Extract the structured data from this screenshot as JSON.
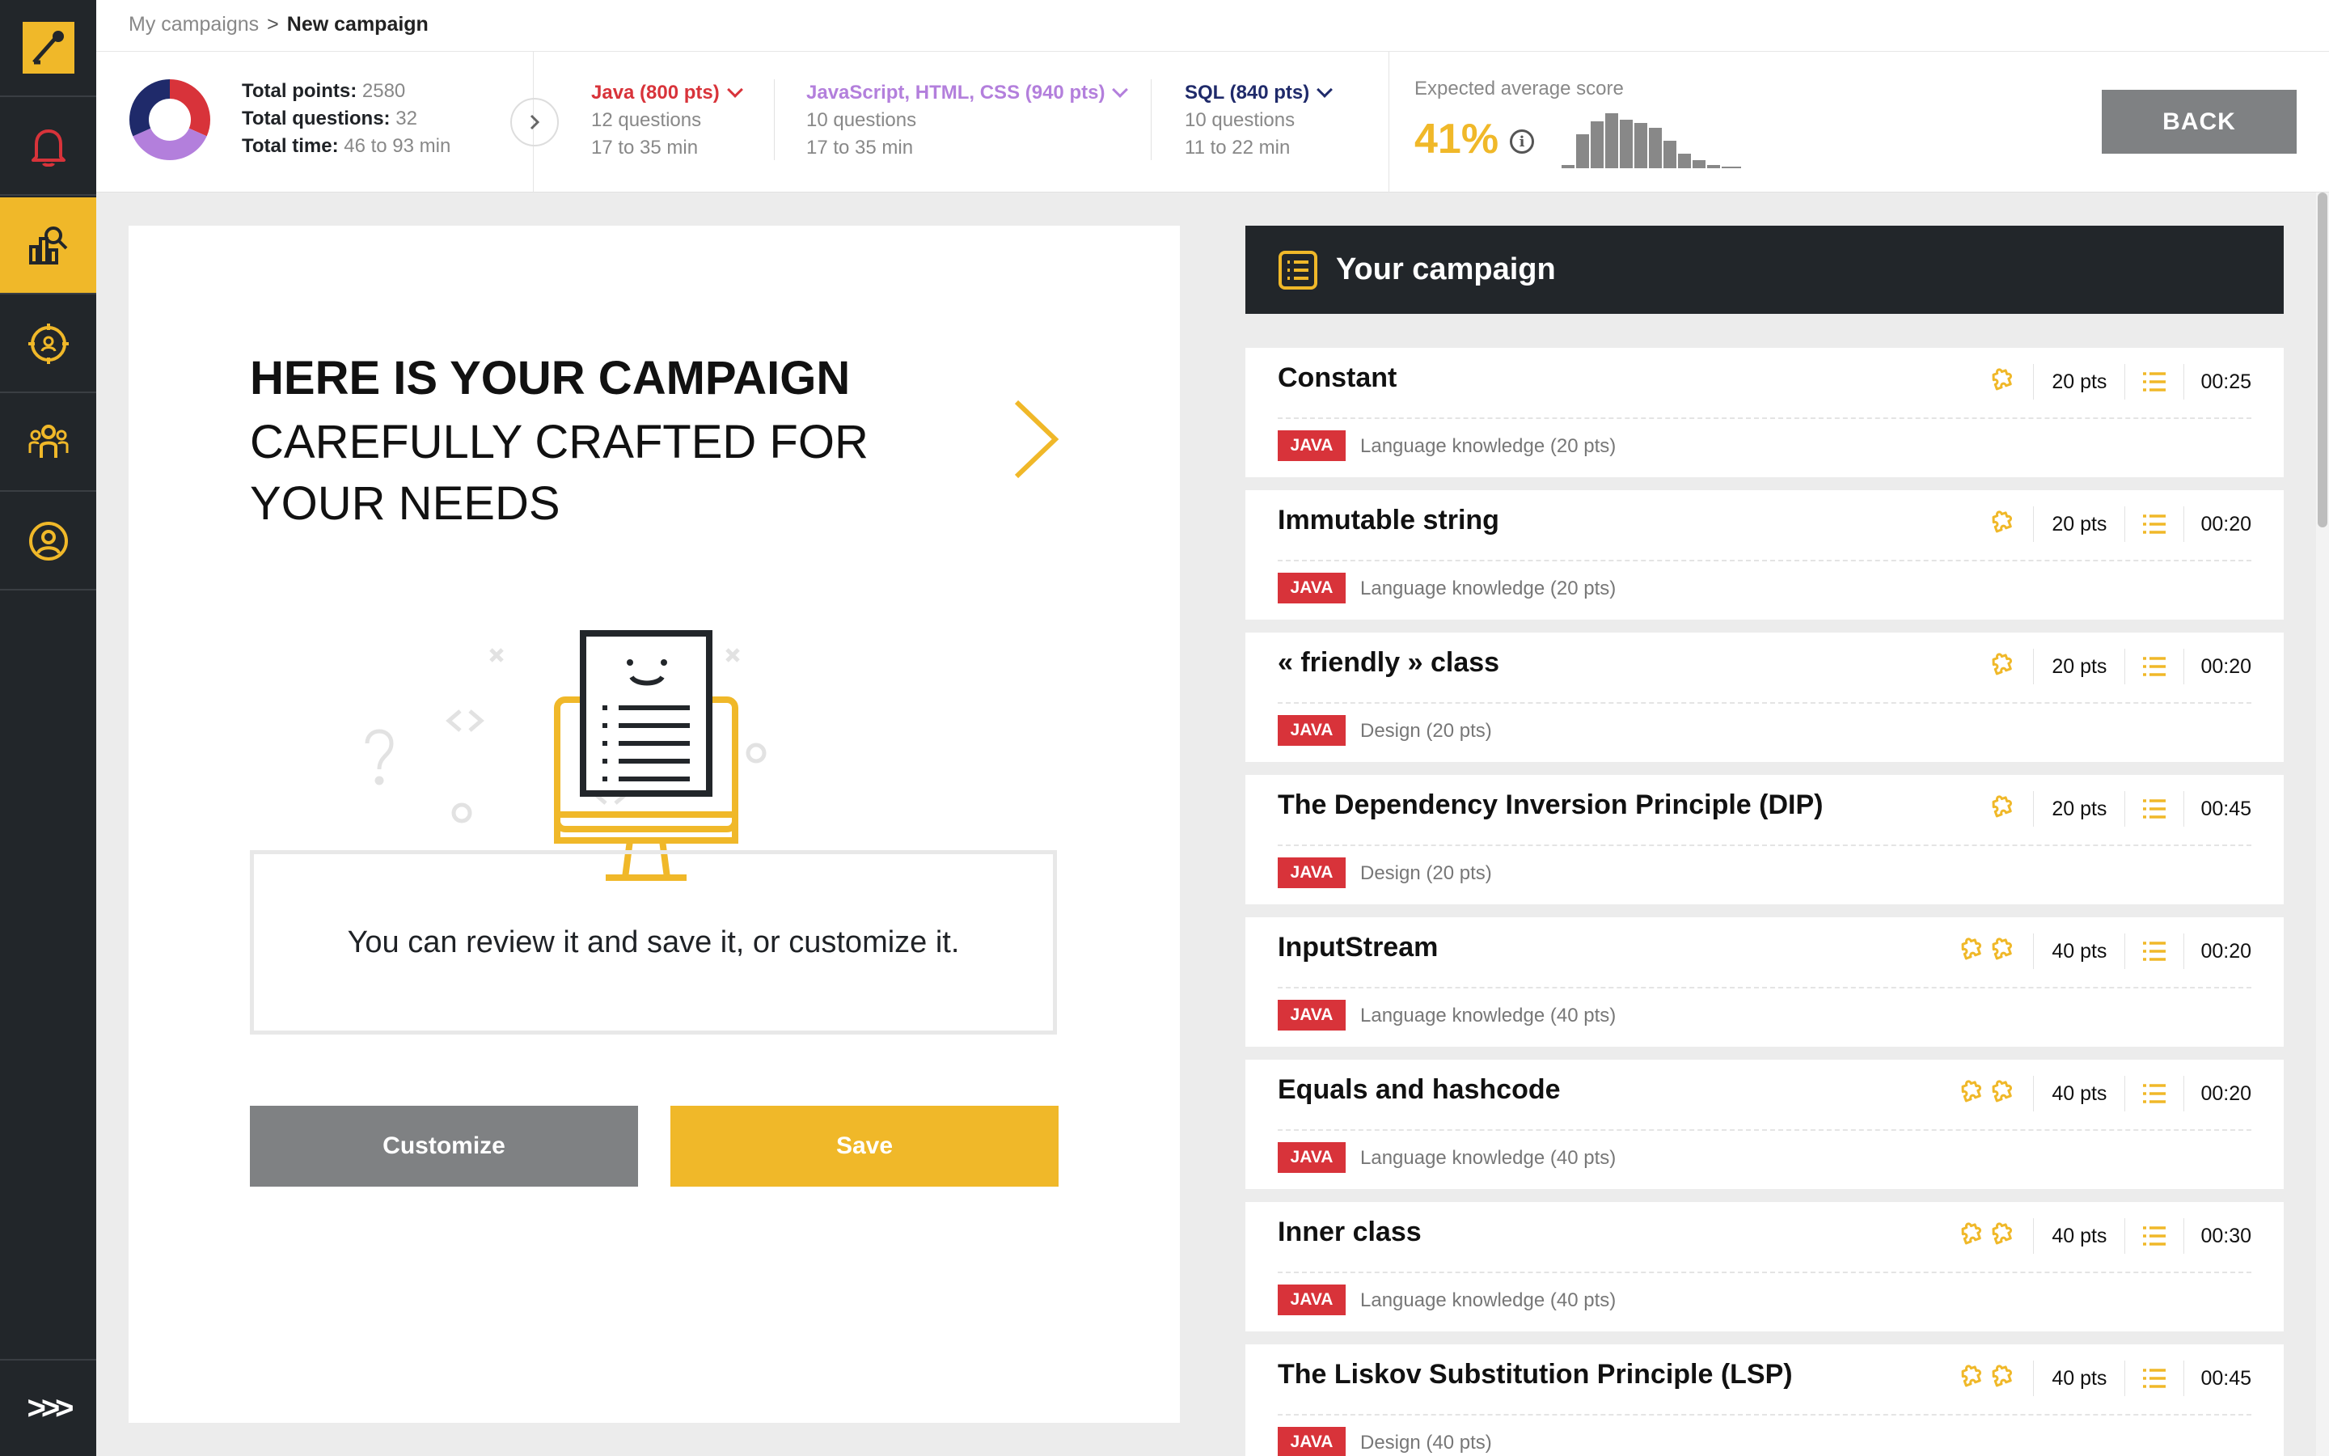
{
  "breadcrumb": {
    "parent": "My campaigns",
    "separator": ">",
    "current": "New campaign"
  },
  "totals": {
    "points_label": "Total points:",
    "points": "2580",
    "questions_label": "Total questions:",
    "questions": "32",
    "time_label": "Total time:",
    "time": "46 to 93 min"
  },
  "skills": [
    {
      "name": "Java (800 pts)",
      "questions": "12 questions",
      "time": "17 to 35 min",
      "color": "#d8333a"
    },
    {
      "name": "JavaScript, HTML, CSS (940 pts)",
      "questions": "10 questions",
      "time": "17 to 35 min",
      "color": "#b37fdc"
    },
    {
      "name": "SQL (840 pts)",
      "questions": "10 questions",
      "time": "11 to 22 min",
      "color": "#1f2a6a"
    }
  ],
  "score": {
    "label": "Expected average score",
    "value": "41%",
    "info_icon": "info-icon"
  },
  "back_label": "BACK",
  "hero": {
    "title": "HERE IS YOUR CAMPAIGN",
    "subtitle": "CAREFULLY CRAFTED FOR YOUR NEEDS",
    "review_text": "You can review it and save it, or customize it."
  },
  "buttons": {
    "customize": "Customize",
    "save": "Save"
  },
  "campaign": {
    "title": "Your campaign",
    "questions": [
      {
        "title": "Constant",
        "pts": "20 pts",
        "time": "00:25",
        "tag": "JAVA",
        "category": "Language knowledge (20 pts)",
        "difficulty": 1
      },
      {
        "title": "Immutable string",
        "pts": "20 pts",
        "time": "00:20",
        "tag": "JAVA",
        "category": "Language knowledge (20 pts)",
        "difficulty": 1
      },
      {
        "title": "« friendly » class",
        "pts": "20 pts",
        "time": "00:20",
        "tag": "JAVA",
        "category": "Design (20 pts)",
        "difficulty": 1
      },
      {
        "title": "The Dependency Inversion Principle (DIP)",
        "pts": "20 pts",
        "time": "00:45",
        "tag": "JAVA",
        "category": "Design (20 pts)",
        "difficulty": 1
      },
      {
        "title": "InputStream",
        "pts": "40 pts",
        "time": "00:20",
        "tag": "JAVA",
        "category": "Language knowledge (40 pts)",
        "difficulty": 2
      },
      {
        "title": "Equals and hashcode",
        "pts": "40 pts",
        "time": "00:20",
        "tag": "JAVA",
        "category": "Language knowledge (40 pts)",
        "difficulty": 2
      },
      {
        "title": "Inner class",
        "pts": "40 pts",
        "time": "00:30",
        "tag": "JAVA",
        "category": "Language knowledge (40 pts)",
        "difficulty": 2
      },
      {
        "title": "The Liskov Substitution Principle (LSP)",
        "pts": "40 pts",
        "time": "00:45",
        "tag": "JAVA",
        "category": "Design (40 pts)",
        "difficulty": 2
      }
    ]
  },
  "colors": {
    "accent": "#f0b829",
    "dark": "#22262a",
    "java": "#d8333a",
    "gray_button": "#7f8183"
  },
  "sidebar": {
    "icons": [
      "logo-icon",
      "bell-icon",
      "dashboard-icon",
      "target-icon",
      "team-icon",
      "user-icon"
    ],
    "expand_label": ">>>"
  }
}
